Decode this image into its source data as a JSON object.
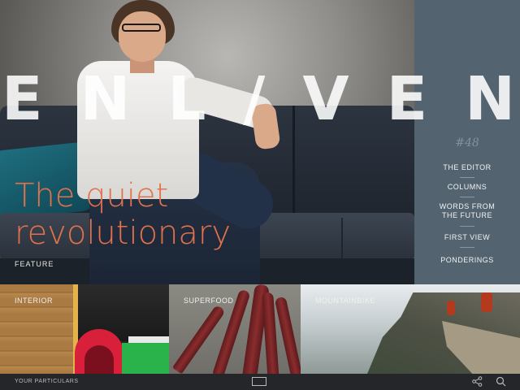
{
  "masthead": {
    "letters": [
      "E",
      "N",
      "L",
      "/",
      "V",
      "E",
      "N"
    ]
  },
  "feature": {
    "title_line1": "The quiet",
    "title_line2": "revolutionary",
    "label": "FEATURE"
  },
  "toc": {
    "issue": "#48",
    "items": [
      "THE EDITOR",
      "COLUMNS",
      "WORDS FROM THE FUTURE",
      "FIRST VIEW",
      "PONDERINGS"
    ]
  },
  "thumbs": [
    {
      "label": "INTERIOR"
    },
    {
      "label": "SUPERFOOD"
    },
    {
      "label": "MOUNTAINBIKE"
    }
  ],
  "bottom_bar": {
    "label": "YOUR PARTICULARS",
    "grid_icon": "grid-view-icon",
    "share_icon": "share-icon",
    "search_icon": "search-icon"
  },
  "colors": {
    "accent": "#e2714c",
    "panel": "#536470",
    "bar": "#24262a"
  }
}
